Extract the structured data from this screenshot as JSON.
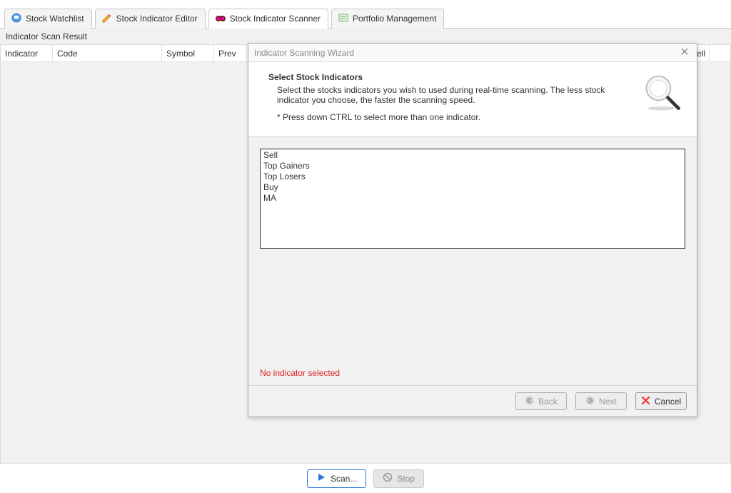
{
  "tabs": [
    {
      "label": "Stock Watchlist"
    },
    {
      "label": "Stock Indicator Editor"
    },
    {
      "label": "Stock Indicator Scanner"
    },
    {
      "label": "Portfolio Management"
    }
  ],
  "subtitle": "Indicator Scan Result",
  "columns": {
    "c0": "Indicator",
    "c1": "Code",
    "c2": "Symbol",
    "c3": "Prev",
    "last": "Sell"
  },
  "bottom": {
    "scan": "Scan...",
    "stop": "Stop"
  },
  "dialog": {
    "title": "Indicator Scanning Wizard",
    "heading": "Select Stock Indicators",
    "desc": "Select the stocks indicators you wish to used during real-time scanning. The less stock indicator you choose, the faster the scanning speed.",
    "hint": "* Press down CTRL to select more than one indicator.",
    "items": [
      "Sell",
      "Top Gainers",
      "Top Losers",
      "Buy",
      "MA"
    ],
    "status": "No indicator selected",
    "back": "Back",
    "next": "Next",
    "cancel": "Cancel"
  }
}
